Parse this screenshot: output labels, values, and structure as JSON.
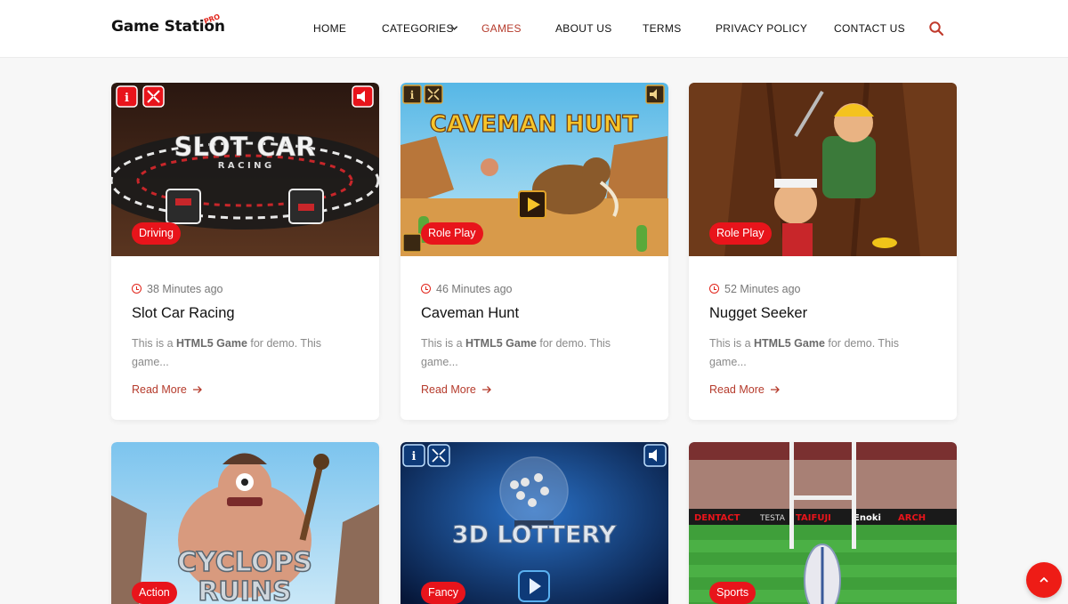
{
  "site": {
    "logo": "Game Station",
    "logo_badge": "PRO"
  },
  "nav": {
    "items": [
      "HOME",
      "CATEGORIES",
      "GAMES",
      "ABOUT US",
      "TERMS",
      "PRIVACY POLICY",
      "CONTACT US"
    ],
    "active": "GAMES",
    "search_icon": "search-icon"
  },
  "colors": {
    "accent": "#e8141b",
    "link": "#b53a2b"
  },
  "cards": [
    {
      "category": "Driving",
      "time": "38 Minutes ago",
      "title": "Slot Car Racing",
      "excerpt_pre": "This is a ",
      "excerpt_bold": "HTML5 Game",
      "excerpt_post": " for demo. This game...",
      "read_more": "Read More",
      "thumb_text": "SLOT CAR",
      "thumb_subtext": "R A C I N G"
    },
    {
      "category": "Role Play",
      "time": "46 Minutes ago",
      "title": "Caveman Hunt",
      "excerpt_pre": "This is a ",
      "excerpt_bold": "HTML5 Game",
      "excerpt_post": " for demo. This game...",
      "read_more": "Read More",
      "thumb_text": "CAVEMAN HUNT"
    },
    {
      "category": "Role Play",
      "time": "52 Minutes ago",
      "title": "Nugget Seeker",
      "excerpt_pre": "This is a ",
      "excerpt_bold": "HTML5 Game",
      "excerpt_post": " for demo. This game...",
      "read_more": "Read More"
    },
    {
      "category": "Action",
      "thumb_text": "CYCLOPS",
      "thumb_subtext": "RUINS"
    },
    {
      "category": "Fancy",
      "thumb_text": "3D LOTTERY"
    },
    {
      "category": "Sports",
      "thumb_ads": [
        "DENTACT",
        "TESTA",
        "TAIFUJI",
        "Enoki",
        "ARCH"
      ]
    }
  ]
}
